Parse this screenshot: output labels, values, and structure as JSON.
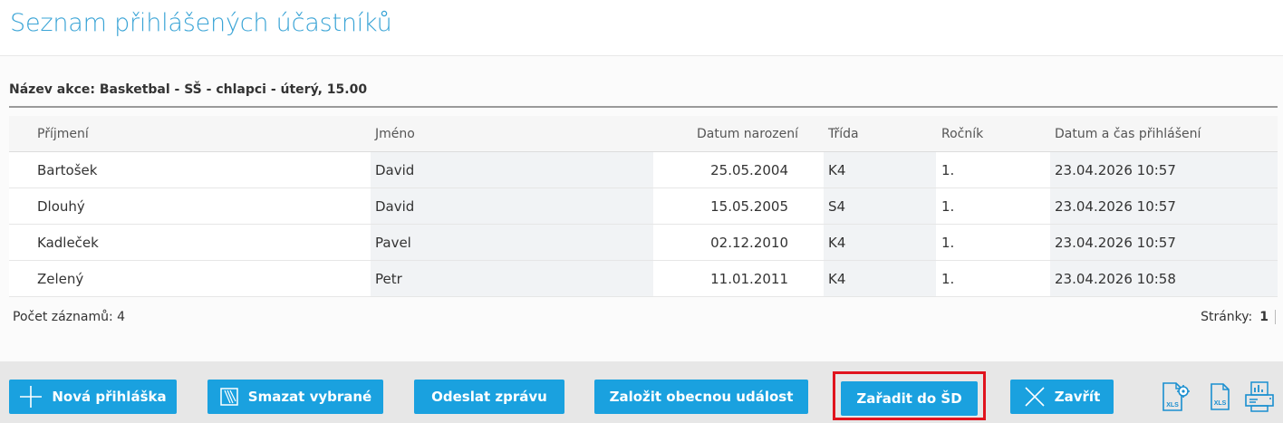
{
  "page": {
    "title": "Seznam přihlášených účastníků"
  },
  "event": {
    "label": "Název akce: Basketbal - SŠ - chlapci - úterý, 15.00"
  },
  "table": {
    "headers": {
      "surname": "Příjmení",
      "name": "Jméno",
      "birth_date": "Datum narození",
      "class": "Třída",
      "year": "Ročník",
      "signup": "Datum a čas přihlášení"
    },
    "rows": [
      {
        "surname": "Bartošek",
        "name": "David",
        "birth_date": "25.05.2004",
        "class": "K4",
        "year": "1.",
        "signup": "23.04.2026 10:57"
      },
      {
        "surname": "Dlouhý",
        "name": "David",
        "birth_date": "15.05.2005",
        "class": "S4",
        "year": "1.",
        "signup": "23.04.2026 10:57"
      },
      {
        "surname": "Kadleček",
        "name": "Pavel",
        "birth_date": "02.12.2010",
        "class": "K4",
        "year": "1.",
        "signup": "23.04.2026 10:57"
      },
      {
        "surname": "Zelený",
        "name": "Petr",
        "birth_date": "11.01.2011",
        "class": "K4",
        "year": "1.",
        "signup": "23.04.2026 10:58"
      }
    ]
  },
  "footer": {
    "record_count": "Počet záznamů: 4",
    "pages_label": "Stránky:",
    "current_page": "1"
  },
  "actions": {
    "new": "Nová přihláška",
    "delete": "Smazat vybrané",
    "message": "Odeslat zprávu",
    "create_event": "Založit obecnou událost",
    "assign": "Zařadit do ŠD",
    "close": "Zavřít"
  },
  "icons": {
    "new": "plus-icon",
    "delete": "eraser-icon",
    "close": "close-icon",
    "export_settings": "xls-settings-icon",
    "export": "xls-icon",
    "print": "print-icon",
    "export_icon_text": "XLS"
  },
  "colors": {
    "accent": "#1aa1df",
    "title": "#3aa4d6",
    "highlight": "#e0141e",
    "icon": "#1a8fd0"
  }
}
